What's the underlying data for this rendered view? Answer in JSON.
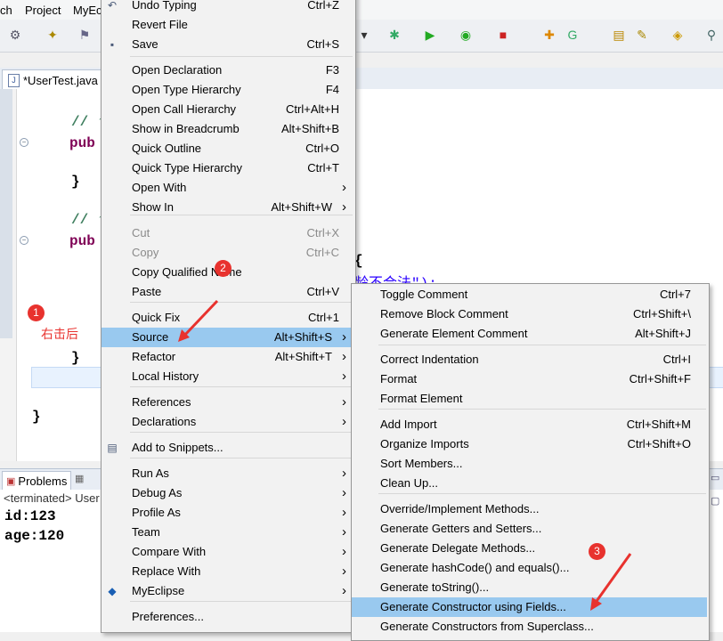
{
  "menubar": {
    "items": [
      "ch",
      "Project",
      "MyEc"
    ]
  },
  "editor": {
    "tab_label": "*UserTest.java",
    "code_lines": [
      {
        "text": "// ↑",
        "color": "#3f7f5f"
      },
      {
        "text": "pub",
        "color": "#7f0055"
      },
      {
        "text": "}",
        "color": "#000000"
      },
      {
        "text": "// ↑",
        "color": "#3f7f5f"
      },
      {
        "text": "pub",
        "color": "#7f0055"
      },
      {
        "text": "{",
        "color": "#000000"
      },
      {
        "text": "龄不合法\");",
        "color": "#2a00ff"
      },
      {
        "text": "}",
        "color": "#000000"
      },
      {
        "text": "}",
        "color": "#000000"
      }
    ]
  },
  "views": {
    "problems_label": "Problems",
    "terminated_label": "<terminated> User",
    "console_lines": [
      "id:123",
      "age:120"
    ]
  },
  "annotations": {
    "step1": "1",
    "step1_text": "右击后",
    "step2": "2",
    "step3": "3",
    "color": "#e8322e"
  },
  "context_menu": {
    "items": [
      {
        "label": "Undo Typing",
        "accel": "Ctrl+Z",
        "icon": "undo-icon"
      },
      {
        "label": "Revert File",
        "accel": ""
      },
      {
        "label": "Save",
        "accel": "Ctrl+S",
        "icon": "save-icon"
      },
      {
        "label": "Open Declaration",
        "accel": "F3"
      },
      {
        "label": "Open Type Hierarchy",
        "accel": "F4"
      },
      {
        "label": "Open Call Hierarchy",
        "accel": "Ctrl+Alt+H"
      },
      {
        "label": "Show in Breadcrumb",
        "accel": "Alt+Shift+B"
      },
      {
        "label": "Quick Outline",
        "accel": "Ctrl+O"
      },
      {
        "label": "Quick Type Hierarchy",
        "accel": "Ctrl+T"
      },
      {
        "label": "Open With",
        "accel": "",
        "submenu": true
      },
      {
        "label": "Show In",
        "accel": "Alt+Shift+W",
        "submenu": true
      },
      {
        "label": "Cut",
        "accel": "Ctrl+X",
        "disabled": true
      },
      {
        "label": "Copy",
        "accel": "Ctrl+C",
        "disabled": true
      },
      {
        "label": "Copy Qualified Name",
        "accel": ""
      },
      {
        "label": "Paste",
        "accel": "Ctrl+V"
      },
      {
        "label": "Quick Fix",
        "accel": "Ctrl+1"
      },
      {
        "label": "Source",
        "accel": "Alt+Shift+S",
        "submenu": true,
        "highlighted": true
      },
      {
        "label": "Refactor",
        "accel": "Alt+Shift+T",
        "submenu": true
      },
      {
        "label": "Local History",
        "accel": "",
        "submenu": true
      },
      {
        "label": "References",
        "accel": "",
        "submenu": true
      },
      {
        "label": "Declarations",
        "accel": "",
        "submenu": true
      },
      {
        "label": "Add to Snippets...",
        "accel": "",
        "icon": "snippet-icon"
      },
      {
        "label": "Run As",
        "accel": "",
        "submenu": true
      },
      {
        "label": "Debug As",
        "accel": "",
        "submenu": true
      },
      {
        "label": "Profile As",
        "accel": "",
        "submenu": true
      },
      {
        "label": "Team",
        "accel": "",
        "submenu": true
      },
      {
        "label": "Compare With",
        "accel": "",
        "submenu": true
      },
      {
        "label": "Replace With",
        "accel": "",
        "submenu": true
      },
      {
        "label": "MyEclipse",
        "accel": "",
        "submenu": true,
        "icon": "myeclipse-icon"
      },
      {
        "label": "Preferences...",
        "accel": ""
      }
    ]
  },
  "source_submenu": {
    "items": [
      {
        "label": "Toggle Comment",
        "accel": "Ctrl+7"
      },
      {
        "label": "Remove Block Comment",
        "accel": "Ctrl+Shift+\\"
      },
      {
        "label": "Generate Element Comment",
        "accel": "Alt+Shift+J"
      },
      {
        "label": "Correct Indentation",
        "accel": "Ctrl+I"
      },
      {
        "label": "Format",
        "accel": "Ctrl+Shift+F"
      },
      {
        "label": "Format Element",
        "accel": ""
      },
      {
        "label": "Add Import",
        "accel": "Ctrl+Shift+M"
      },
      {
        "label": "Organize Imports",
        "accel": "Ctrl+Shift+O"
      },
      {
        "label": "Sort Members...",
        "accel": ""
      },
      {
        "label": "Clean Up...",
        "accel": ""
      },
      {
        "label": "Override/Implement Methods...",
        "accel": ""
      },
      {
        "label": "Generate Getters and Setters...",
        "accel": ""
      },
      {
        "label": "Generate Delegate Methods...",
        "accel": ""
      },
      {
        "label": "Generate hashCode() and equals()...",
        "accel": ""
      },
      {
        "label": "Generate toString()...",
        "accel": ""
      },
      {
        "label": "Generate Constructor using Fields...",
        "accel": "",
        "highlighted": true
      },
      {
        "label": "Generate Constructors from Superclass...",
        "accel": ""
      }
    ]
  }
}
